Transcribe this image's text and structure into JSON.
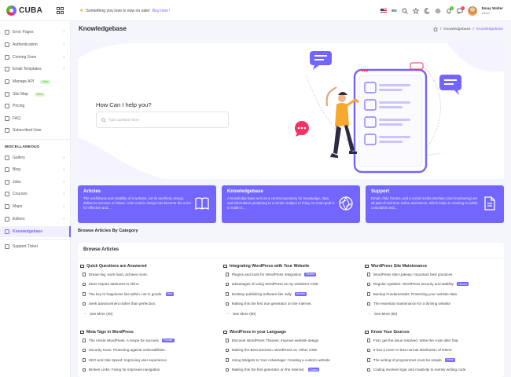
{
  "header": {
    "logo_text": "CUBA",
    "promo_text": "Something you love is now on sale!",
    "promo_link": "Buy now !",
    "language": "EN",
    "notification_count": "4",
    "message_count": "2",
    "user_name": "Emay Walter",
    "user_role": "Admin"
  },
  "sidebar": {
    "items_top": [
      {
        "label": "Error Pages",
        "chevron": "›"
      },
      {
        "label": "Authentication",
        "chevron": "›"
      },
      {
        "label": "Coming Soon",
        "chevron": "›"
      },
      {
        "label": "Email Templates",
        "chevron": "›"
      },
      {
        "label": "Manage API",
        "badge": "New"
      },
      {
        "label": "Site Map",
        "badge": "New"
      },
      {
        "label": "Pricing"
      },
      {
        "label": "FAQ"
      },
      {
        "label": "Subscribed User"
      }
    ],
    "section_label": "MISCELLANEOUS",
    "items_misc": [
      {
        "label": "Gallery",
        "chevron": "›"
      },
      {
        "label": "Blog",
        "chevron": "›"
      },
      {
        "label": "Jobs",
        "chevron": "›"
      },
      {
        "label": "Courses",
        "chevron": "›"
      },
      {
        "label": "Maps",
        "chevron": "›"
      },
      {
        "label": "Editors",
        "chevron": "›"
      },
      {
        "label": "Knowledgebase"
      }
    ],
    "support": "Support Ticket"
  },
  "page": {
    "title": "Knowledgebase",
    "breadcrumb": [
      "Knowledgebase",
      "Knowledgebase"
    ]
  },
  "hero": {
    "question": "How Can I help you?",
    "search_placeholder": "Type question here"
  },
  "cards": [
    {
      "title": "Articles",
      "text": "The usefulness and usability of a website, not its aesthetic design, define its success or failure. User-centric design has become the norm for effective and...",
      "icon": "book-icon"
    },
    {
      "title": "Knowledgebase",
      "text": "A knowledge base acts as a central repository for knowledge, data, and information pertaining to a certain subject or thing. Its main goal is to make it...",
      "icon": "aperture-icon"
    },
    {
      "title": "Support",
      "text": "Email, chat, forums, and a social media interface (and monitoring) are all part of real-time online assistance, which helps in reacting to public complaints and...",
      "icon": "file-icon"
    }
  ],
  "browse_category_label": "Browse Articles By Category",
  "browse": {
    "heading": "Browse Articles",
    "columns": [
      {
        "title": "Quick Questions are Answered",
        "items": [
          {
            "text": "Dream big, work hard, achieve more."
          },
          {
            "text": "Stars require darkness to shine."
          },
          {
            "text": "The key to happiness lies within, not in goods.",
            "tag": "New"
          },
          {
            "text": "Seek advancement rather than perfection."
          }
        ],
        "more": "See More (40)"
      },
      {
        "title": "Integrating WordPress with Your Website",
        "items": [
          {
            "text": "Plugins and tools for WordPress Integration",
            "tag": "Review"
          },
          {
            "text": "advantages of using WordPress as my website's CMS"
          },
          {
            "text": "Desktop publishing software like Jully",
            "tag": "Articles"
          },
          {
            "text": "Making this the first true generator on the Internet."
          }
        ],
        "more": "See More (90)"
      },
      {
        "title": "WordPress Site Maintenance",
        "items": [
          {
            "text": "WordPress Site Upkeep: Important best practices"
          },
          {
            "text": "Regular Updates: WordPress security and stability",
            "tag": "Closed"
          },
          {
            "text": "Backup Fundamentals: Protecting your website data"
          },
          {
            "text": "The essential maintenance for a thriving website"
          }
        ],
        "more": "See More (50)"
      },
      {
        "title": "Meta Tags in WordPress",
        "items": [
          {
            "text": "The Article WordPress: A recipe for success",
            "tag": "Popular"
          },
          {
            "text": "Security Scan: Protecting against vulnerabilities."
          },
          {
            "text": "SEO and Site Speed: Improving user experience"
          },
          {
            "text": "Broken Links: Fixing for improved navigation"
          }
        ]
      },
      {
        "title": "WordPress in your Language",
        "items": [
          {
            "text": "Discover WordPress Themes: Improve website design"
          },
          {
            "text": "Making the Best Decision: WordPress vs. Other CMS"
          },
          {
            "text": "Using Widgets to Your Advantage: Creating a custom website"
          },
          {
            "text": "Making this the first generator on the Internet.",
            "tag": "Closed"
          }
        ]
      },
      {
        "title": "Know Your Sources",
        "items": [
          {
            "text": "First, get the issue resolved. Write the code after that."
          },
          {
            "text": "It has a more-or-less normal distribution of letters"
          },
          {
            "text": "The writing of programmes must be simple",
            "tag": "Article"
          },
          {
            "text": "Coding involves logic and creativity to merely writing code"
          }
        ]
      }
    ]
  },
  "colors": {
    "accent": "#7366ff",
    "new_badge_bg": "#d9f5d0",
    "new_badge_fg": "#51bb25",
    "danger": "#f73164",
    "warning": "#f8a830"
  }
}
